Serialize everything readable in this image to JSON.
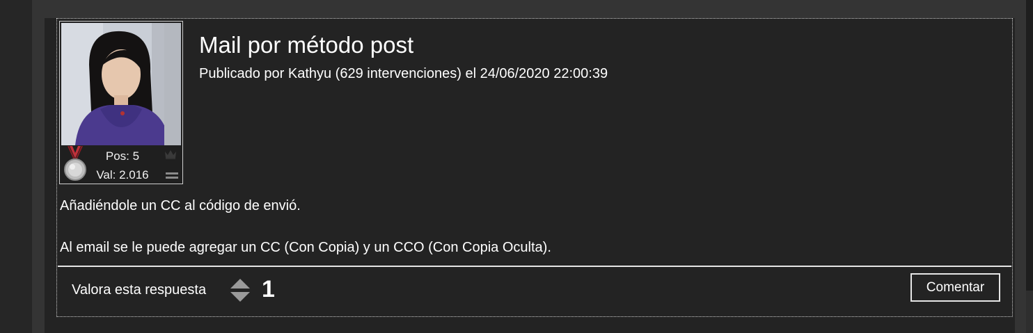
{
  "post": {
    "title": "Mail por método post",
    "meta": "Publicado por Kathyu (629 intervenciones) el 24/06/2020 22:00:39",
    "body": [
      "Añadiéndole un CC al código de envió.",
      "Al email se le puede agregar un CC (Con Copia) y un CCO (Con Copia Oculta)."
    ]
  },
  "author": {
    "pos_label": "Pos: 5",
    "val_label": "Val: 2.016",
    "medal_icon": "silver-medal-icon",
    "rank_icon": "crown-icon",
    "trend_icon": "equal-icon"
  },
  "rating": {
    "label": "Valora esta respuesta",
    "count": "1",
    "up_icon": "arrow-up-icon",
    "down_icon": "arrow-down-icon"
  },
  "actions": {
    "comment_label": "Comentar"
  },
  "colors": {
    "page_bg": "#2b2b2b",
    "card_bg": "#232323",
    "border": "#cfcfcf",
    "arrow": "#9a9a9a",
    "text": "#ffffff"
  }
}
